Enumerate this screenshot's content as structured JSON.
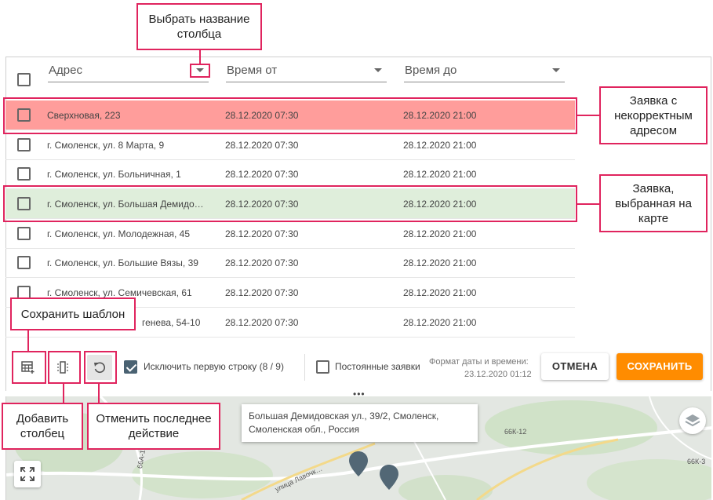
{
  "table": {
    "columns": [
      {
        "label": "Адрес"
      },
      {
        "label": "Время от"
      },
      {
        "label": "Время до"
      }
    ],
    "rows": [
      {
        "address": "Сверхновая, 223",
        "from": "28.12.2020 07:30",
        "to": "28.12.2020 21:00",
        "state": "invalid"
      },
      {
        "address": "г. Смоленск, ул. 8 Марта, 9",
        "from": "28.12.2020 07:30",
        "to": "28.12.2020 21:00",
        "state": "normal"
      },
      {
        "address": "г. Смоленск, ул. Больничная, 1",
        "from": "28.12.2020 07:30",
        "to": "28.12.2020 21:00",
        "state": "normal"
      },
      {
        "address": "г. Смоленск, ул. Большая Демидо…",
        "from": "28.12.2020 07:30",
        "to": "28.12.2020 21:00",
        "state": "selected"
      },
      {
        "address": "г. Смоленск, ул. Молодежная, 45",
        "from": "28.12.2020 07:30",
        "to": "28.12.2020 21:00",
        "state": "normal"
      },
      {
        "address": "г. Смоленск, ул. Большие Вязы, 39",
        "from": "28.12.2020 07:30",
        "to": "28.12.2020 21:00",
        "state": "normal"
      },
      {
        "address": "г. Смоленск, ул. Семичевская, 61",
        "from": "28.12.2020 07:30",
        "to": "28.12.2020 21:00",
        "state": "normal"
      },
      {
        "address": "генева, 54-10",
        "from": "28.12.2020 07:30",
        "to": "28.12.2020 21:00",
        "state": "normal"
      }
    ]
  },
  "toolbar": {
    "exclude_first_row": "Исключить первую строку (8 / 9)",
    "permanent_orders": "Постоянные заявки",
    "date_format_label": "Формат даты и времени:",
    "date_format_value": "23.12.2020 01:12",
    "cancel_label": "ОТМЕНА",
    "save_label": "СОХРАНИТЬ"
  },
  "callouts": {
    "choose_column": "Выбрать название столбца",
    "invalid_address": "Заявка с некорректным адресом",
    "selected_on_map": "Заявка, выбранная на карте",
    "save_template": "Сохранить шаблон",
    "add_column": "Добавить столбец",
    "undo": "Отменить последнее действие"
  },
  "map": {
    "tooltip": "Большая Демидовская ул., 39/2, Смоленск, Смоленская обл., Россия",
    "road_labels": [
      "66К-12",
      "66К-3",
      "66А-1",
      "улица Лавочк…"
    ]
  },
  "colors": {
    "invalid_row": "#ff9d9b",
    "selected_row": "#dfeedb",
    "accent": "#ff8c00",
    "callout_border": "#e0245e"
  },
  "icons": [
    "table-template-icon",
    "add-column-icon",
    "undo-icon",
    "layers-icon",
    "fullscreen-icon",
    "map-marker-icon"
  ]
}
